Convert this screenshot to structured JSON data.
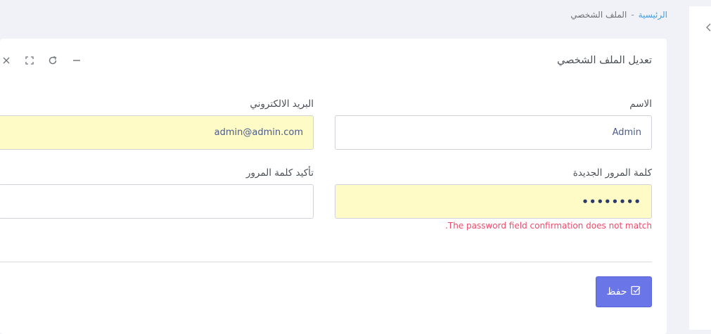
{
  "breadcrumb": {
    "home": "الرئيسية",
    "separator": "-",
    "current": "الملف الشخصي"
  },
  "card": {
    "title": "تعديل الملف الشخصي",
    "tools": [
      "minus-icon",
      "refresh-icon",
      "expand-icon",
      "close-icon"
    ]
  },
  "form": {
    "name_label": "الاسم",
    "name_value": "Admin",
    "email_label": "البريد الالكتروني",
    "email_value": "admin@admin.com",
    "password_label": "كلمة المرور الجديدة",
    "password_value": "••••••••",
    "password_confirm_label": "تأكيد كلمة المرور",
    "password_confirm_value": "",
    "password_error": ".The password field confirmation does not match"
  },
  "save_button": {
    "label": "حفظ",
    "icon": "check-square-icon"
  },
  "colors": {
    "primary": "#6a76e8",
    "autofill": "#fefbc6",
    "error": "#ef4a6a",
    "link": "#3da0e4"
  }
}
